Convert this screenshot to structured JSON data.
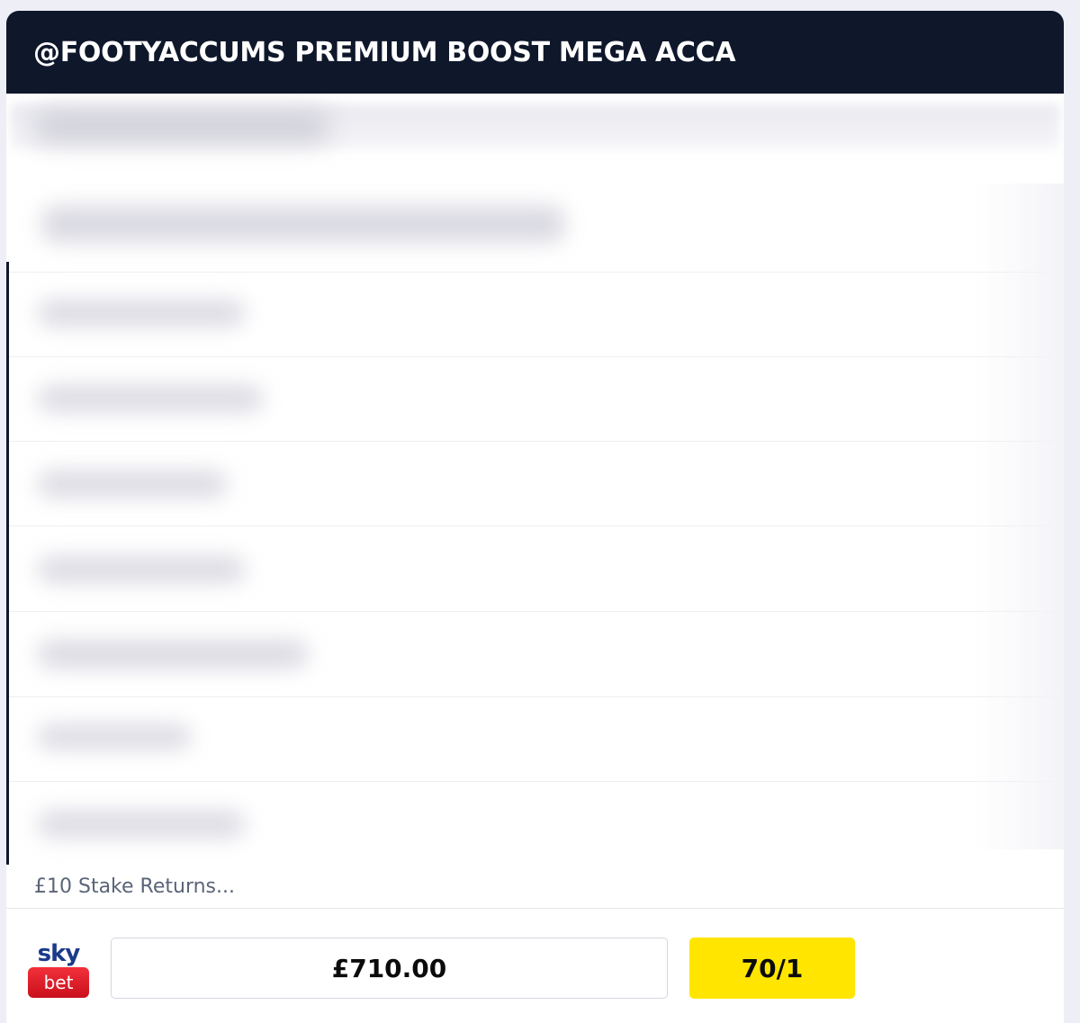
{
  "header": {
    "title": "@FOOTYACCUMS PREMIUM BOOST MEGA ACCA"
  },
  "selections": {
    "count": 7,
    "obscured": true
  },
  "stake": {
    "label": "£10 Stake Returns..."
  },
  "bookmaker": {
    "logo_top": "sky",
    "logo_bottom": "bet",
    "logo_colors": {
      "sky": "#1b3a8a",
      "bet": "#e0121f"
    }
  },
  "returns": {
    "value": "£710.00"
  },
  "odds": {
    "value": "70/1",
    "color": "#ffe500"
  },
  "colors": {
    "header_bg": "#0f172b",
    "page_bg": "#eeeef6",
    "stake_text": "#5b6478"
  }
}
